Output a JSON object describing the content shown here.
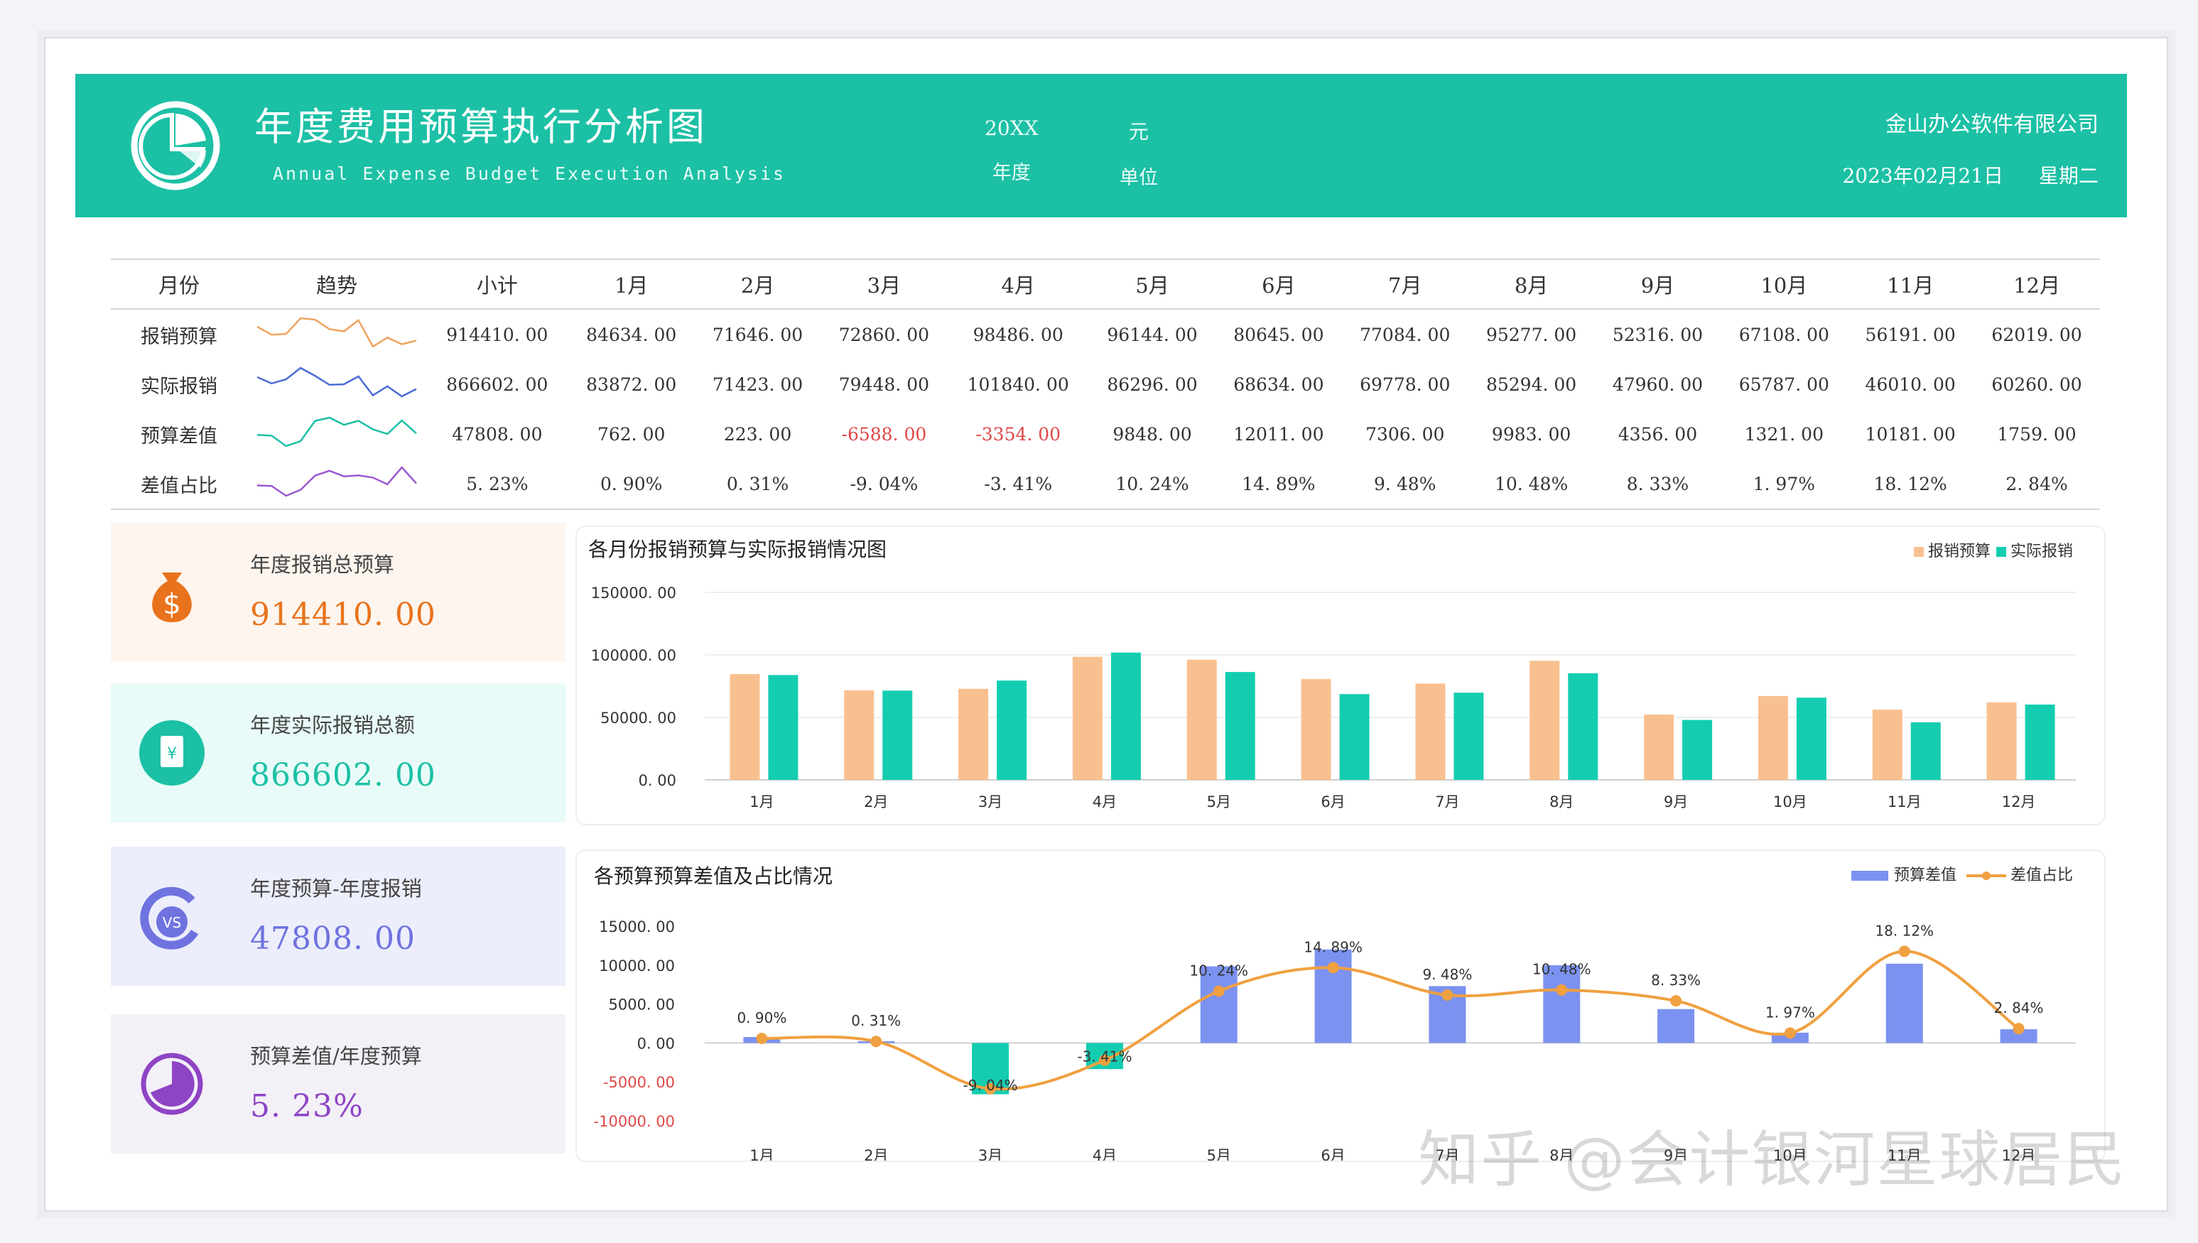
{
  "header": {
    "title": "年度费用预算执行分析图",
    "subtitle": "Annual Expense Budget Execution Analysis",
    "year_value": "20XX",
    "year_label": "年度",
    "unit_value": "元",
    "unit_label": "单位",
    "company": "金山办公软件有限公司",
    "date": "2023年02月21日",
    "weekday": "星期二"
  },
  "table": {
    "headers": [
      "月份",
      "趋势",
      "小计",
      "1月",
      "2月",
      "3月",
      "4月",
      "5月",
      "6月",
      "7月",
      "8月",
      "9月",
      "10月",
      "11月",
      "12月"
    ],
    "rows": [
      {
        "name": "报销预算",
        "total": "914410.00",
        "values": [
          "84634.00",
          "71646.00",
          "72860.00",
          "98486.00",
          "96144.00",
          "80645.00",
          "77084.00",
          "95277.00",
          "52316.00",
          "67108.00",
          "56191.00",
          "62019.00"
        ],
        "trend_color": "#f0a35e"
      },
      {
        "name": "实际报销",
        "total": "866602.00",
        "values": [
          "83872.00",
          "71423.00",
          "79448.00",
          "101840.00",
          "86296.00",
          "68634.00",
          "69778.00",
          "85294.00",
          "47960.00",
          "65787.00",
          "46010.00",
          "60260.00"
        ],
        "trend_color": "#4a6bd6"
      },
      {
        "name": "预算差值",
        "total": "47808.00",
        "values": [
          "762.00",
          "223.00",
          "-6588.00",
          "-3354.00",
          "9848.00",
          "12011.00",
          "7306.00",
          "9983.00",
          "4356.00",
          "1321.00",
          "10181.00",
          "1759.00"
        ],
        "trend_color": "#1cc0a5"
      },
      {
        "name": "差值占比",
        "total": "5.23%",
        "values": [
          "0.90%",
          "0.31%",
          "-9.04%",
          "-3.41%",
          "10.24%",
          "14.89%",
          "9.48%",
          "10.48%",
          "8.33%",
          "1.97%",
          "18.12%",
          "2.84%"
        ],
        "trend_color": "#9b59d0"
      }
    ]
  },
  "kpis": [
    {
      "label": "年度报销总预算",
      "value": "914410.00",
      "color": "#e9731c",
      "bg": "#fdf5ee",
      "icon": "money-bag-icon"
    },
    {
      "label": "年度实际报销总额",
      "value": "866602.00",
      "color": "#1cc0a5",
      "bg": "#e8fbf8",
      "icon": "receipt-icon"
    },
    {
      "label": "年度预算-年度报销",
      "value": "47808.00",
      "color": "#6f73e0",
      "bg": "#eceefb",
      "icon": "vs-icon"
    },
    {
      "label": "预算差值/年度预算",
      "value": "5.23%",
      "color": "#8e44c4",
      "bg": "#f3f0f7",
      "icon": "pie-icon"
    }
  ],
  "watermark": "知乎 @会计银河星球居民",
  "chart_data": [
    {
      "type": "bar",
      "title": "各月份报销预算与实际报销情况图",
      "categories": [
        "1月",
        "2月",
        "3月",
        "4月",
        "5月",
        "6月",
        "7月",
        "8月",
        "9月",
        "10月",
        "11月",
        "12月"
      ],
      "ylim": [
        0,
        150000
      ],
      "yticks": [
        "0.00",
        "50000.00",
        "100000.00",
        "150000.00"
      ],
      "legend_position": "top-right",
      "series": [
        {
          "name": "报销预算",
          "color": "#f9c08f",
          "values": [
            84634,
            71646,
            72860,
            98486,
            96144,
            80645,
            77084,
            95277,
            52316,
            67108,
            56191,
            62019
          ]
        },
        {
          "name": "实际报销",
          "color": "#14cdb1",
          "values": [
            83872,
            71423,
            79448,
            101840,
            86296,
            68634,
            69778,
            85294,
            47960,
            65787,
            46010,
            60260
          ]
        }
      ]
    },
    {
      "type": "bar+line",
      "title": "各预算预算差值及占比情况",
      "categories": [
        "1月",
        "2月",
        "3月",
        "4月",
        "5月",
        "6月",
        "7月",
        "8月",
        "9月",
        "10月",
        "11月",
        "12月"
      ],
      "ylim": [
        -10000,
        15000
      ],
      "yticks": [
        "-10000.00",
        "-5000.00",
        "0.00",
        "5000.00",
        "10000.00",
        "15000.00"
      ],
      "legend_position": "top-right",
      "series": [
        {
          "name": "预算差值",
          "type": "bar",
          "color": "#7b92f0",
          "neg_color": "#14cdb1",
          "values": [
            762,
            223,
            -6588,
            -3354,
            9848,
            12011,
            7306,
            9983,
            4356,
            1321,
            10181,
            1759
          ]
        },
        {
          "name": "差值占比",
          "type": "line",
          "color": "#f0a040",
          "values": [
            0.9,
            0.31,
            -9.04,
            -3.41,
            10.24,
            14.89,
            9.48,
            10.48,
            8.33,
            1.97,
            18.12,
            2.84
          ],
          "labels": [
            "0.90%",
            "0.31%",
            "-9.04%",
            "-3.41%",
            "10.24%",
            "14.89%",
            "9.48%",
            "10.48%",
            "8.33%",
            "1.97%",
            "18.12%",
            "2.84%"
          ]
        }
      ]
    }
  ]
}
